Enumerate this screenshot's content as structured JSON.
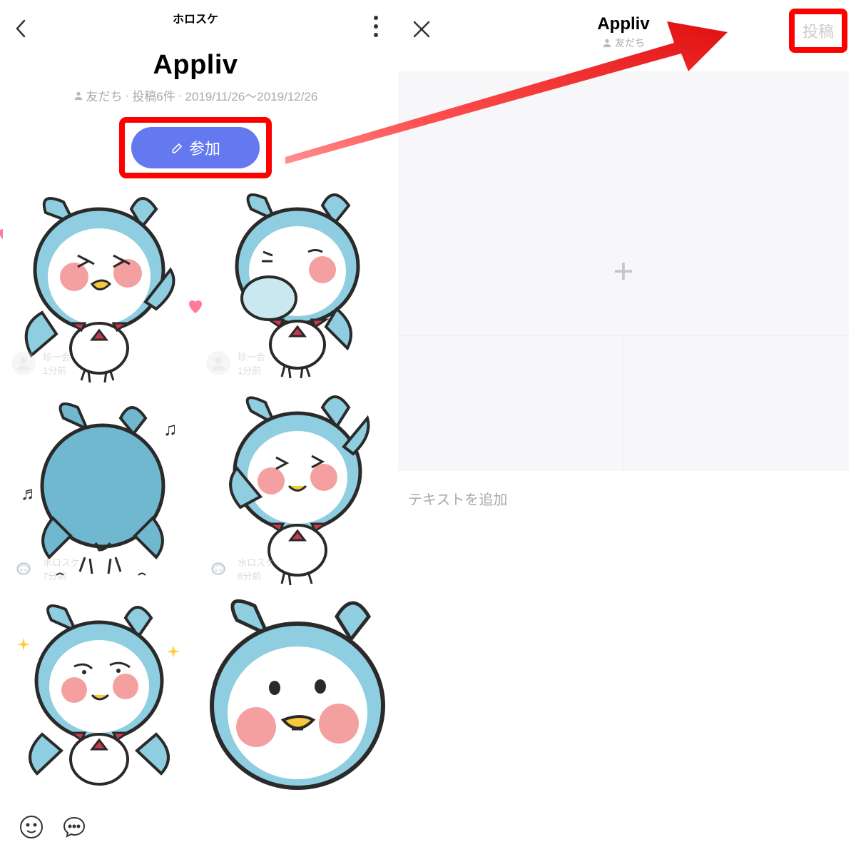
{
  "left": {
    "header_label": "ホロスケ",
    "title": "Appliv",
    "meta": {
      "friends": "友だち",
      "posts": "投稿6件",
      "dates": "2019/11/26～2019/12/26"
    },
    "join_label": "参加",
    "posts": [
      {
        "name": "珍一会",
        "time": "1分前"
      },
      {
        "name": "珍一会",
        "time": "1分前"
      },
      {
        "name": "水ロスケ",
        "time": "7分前"
      },
      {
        "name": "水ロスケ",
        "time": "8分前"
      }
    ]
  },
  "right": {
    "title": "Appliv",
    "sub": "友だち",
    "post_button": "投稿",
    "text_placeholder": "テキストを追加"
  },
  "colors": {
    "accent": "#6478f0",
    "highlight": "#ff0000",
    "penguin_body": "#8fcde0",
    "penguin_dark": "#2a2a2a",
    "cheek": "#f5a0a0",
    "bow": "#c73a4e",
    "beak": "#f5c93a"
  }
}
